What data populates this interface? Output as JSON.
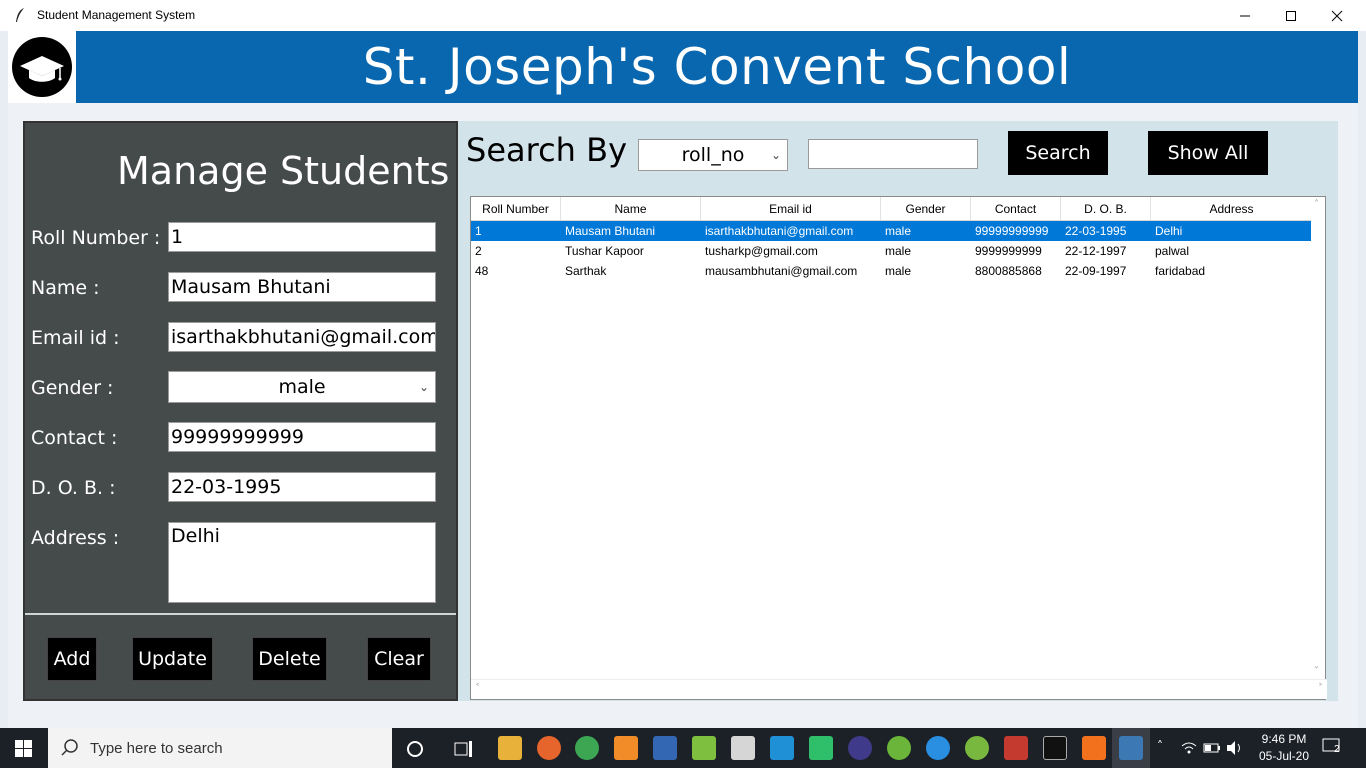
{
  "window": {
    "title": "Student Management System"
  },
  "header": {
    "title": "St. Joseph's Convent School"
  },
  "manage": {
    "title": "Manage Students",
    "fields": [
      {
        "label": "Roll Number :",
        "value": "1"
      },
      {
        "label": "Name :",
        "value": "Mausam Bhutani"
      },
      {
        "label": "Email id :",
        "value": "isarthakbhutani@gmail.com"
      },
      {
        "label": "Gender :",
        "value": "male"
      },
      {
        "label": "Contact :",
        "value": "99999999999"
      },
      {
        "label": "D. O. B. :",
        "value": "22-03-1995"
      },
      {
        "label": "Address :",
        "value": "Delhi"
      }
    ],
    "buttons": {
      "add": "Add",
      "update": "Update",
      "delete": "Delete",
      "clear": "Clear"
    }
  },
  "search": {
    "label": "Search By :",
    "selected": "roll_no",
    "text": "",
    "search_button": "Search",
    "show_all_button": "Show All"
  },
  "table": {
    "columns": [
      "Roll Number",
      "Name",
      "Email id",
      "Gender",
      "Contact",
      "D. O. B.",
      "Address"
    ],
    "rows": [
      {
        "roll": "1",
        "name": "Mausam Bhutani",
        "email": "isarthakbhutani@gmail.com",
        "gender": "male",
        "contact": "99999999999",
        "dob": "22-03-1995",
        "address": "Delhi",
        "selected": true
      },
      {
        "roll": "2",
        "name": "Tushar Kapoor",
        "email": "tusharkp@gmail.com",
        "gender": "male",
        "contact": "9999999999",
        "dob": "22-12-1997",
        "address": "palwal",
        "selected": false
      },
      {
        "roll": "48",
        "name": "Sarthak",
        "email": "mausambhutani@gmail.com",
        "gender": "male",
        "contact": "8800885868",
        "dob": "22-09-1997",
        "address": "faridabad",
        "selected": false
      }
    ]
  },
  "taskbar": {
    "search_placeholder": "Type here to search",
    "time": "9:46 PM",
    "date": "05-Jul-20",
    "notifications": "2"
  },
  "colors": {
    "banner": "#0867ae",
    "manage_bg": "#454a4b",
    "details_bg": "#d3e3ea",
    "selected_row": "#0078d7"
  }
}
